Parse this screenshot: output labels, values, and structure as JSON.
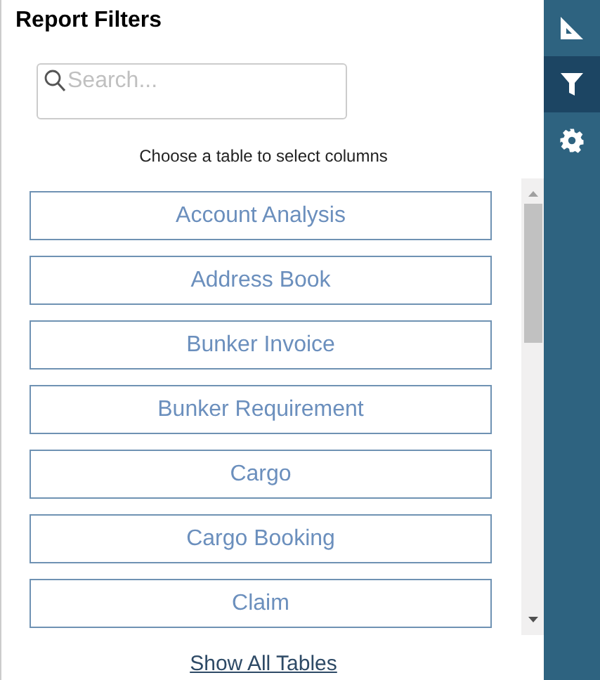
{
  "panel": {
    "title": "Report Filters"
  },
  "search": {
    "placeholder": "Search..."
  },
  "instruction": "Choose a table to select columns",
  "tables": [
    "Account Analysis",
    "Address Book",
    "Bunker Invoice",
    "Bunker Requirement",
    "Cargo",
    "Cargo Booking",
    "Claim"
  ],
  "show_all_link": "Show All Tables",
  "sidebar": {
    "items": [
      {
        "kind": "ruler",
        "selected": false
      },
      {
        "kind": "filter",
        "selected": true
      },
      {
        "kind": "settings",
        "selected": false
      }
    ]
  }
}
